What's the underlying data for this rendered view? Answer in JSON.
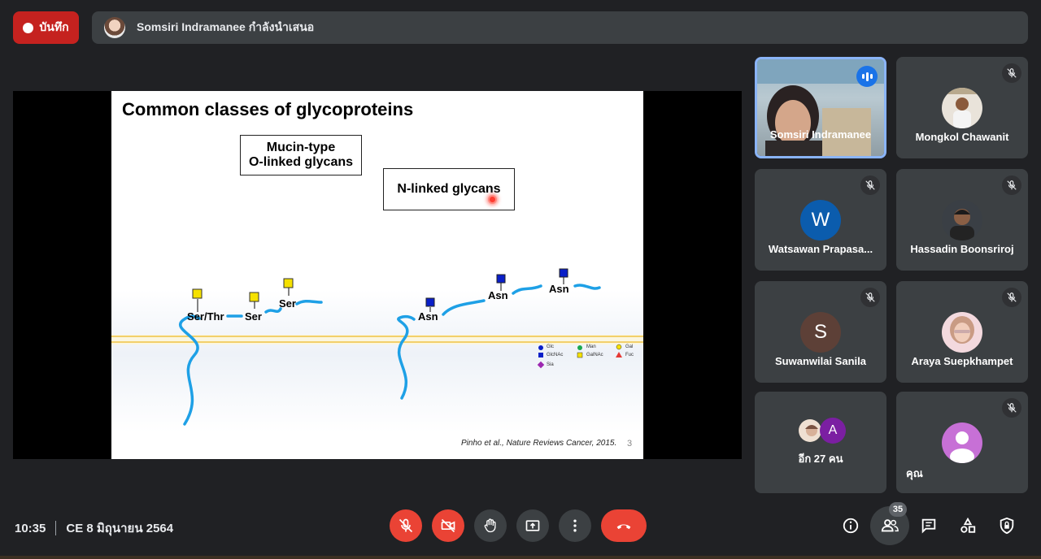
{
  "topbar": {
    "record_label": "บันทึก",
    "presenter_text": "Somsiri Indramanee กำลังนำเสนอ"
  },
  "slide": {
    "title": "Common classes of glycoproteins",
    "box_mucin_line1": "Mucin-type",
    "box_mucin_line2": "O-linked glycans",
    "box_n": "N-linked glycans",
    "labels": {
      "ser_thr": "Ser/Thr",
      "ser1": "Ser",
      "ser2": "Ser",
      "asn1": "Asn",
      "asn2": "Asn",
      "asn3": "Asn"
    },
    "legend": {
      "glc": "Glc",
      "man": "Man",
      "gal": "Gal",
      "glcnac": "GlcNAc",
      "galnac": "GalNAc",
      "fuc": "Fuc",
      "sia": "Sia"
    },
    "citation": "Pinho et al., Nature Reviews Cancer, 2015.",
    "page_number": "3",
    "colors": {
      "membrane": "#f2d06b",
      "protein": "#1ea0e6",
      "galnac": "#f5e100",
      "glcnac": "#0a1fc8"
    }
  },
  "participants": [
    {
      "name": "Somsiri Indramanee",
      "speaking": true
    },
    {
      "name": "Mongkol Chawanit"
    },
    {
      "name": "Watsawan Prapasa...",
      "initial": "W",
      "color": "#0b5cad"
    },
    {
      "name": "Hassadin Boonsriroj"
    },
    {
      "name": "Suwanwilai Sanila",
      "initial": "S",
      "color": "#5d4037"
    },
    {
      "name": "Araya Suepkhampet"
    },
    {
      "name": "อีก 27 คน",
      "initial": "A",
      "color": "#7b1fa2"
    },
    {
      "name": "คุณ",
      "color": "#c770d6"
    }
  ],
  "bottombar": {
    "time": "10:35",
    "meeting": "CE 8 มิถุนายน 2564",
    "people_count": "35"
  },
  "icons": [
    "mic-off-icon",
    "camera-off-icon",
    "hand-icon",
    "present-icon",
    "more-icon",
    "hangup-icon",
    "info-icon",
    "people-icon",
    "chat-icon",
    "activities-icon",
    "shield-icon"
  ]
}
